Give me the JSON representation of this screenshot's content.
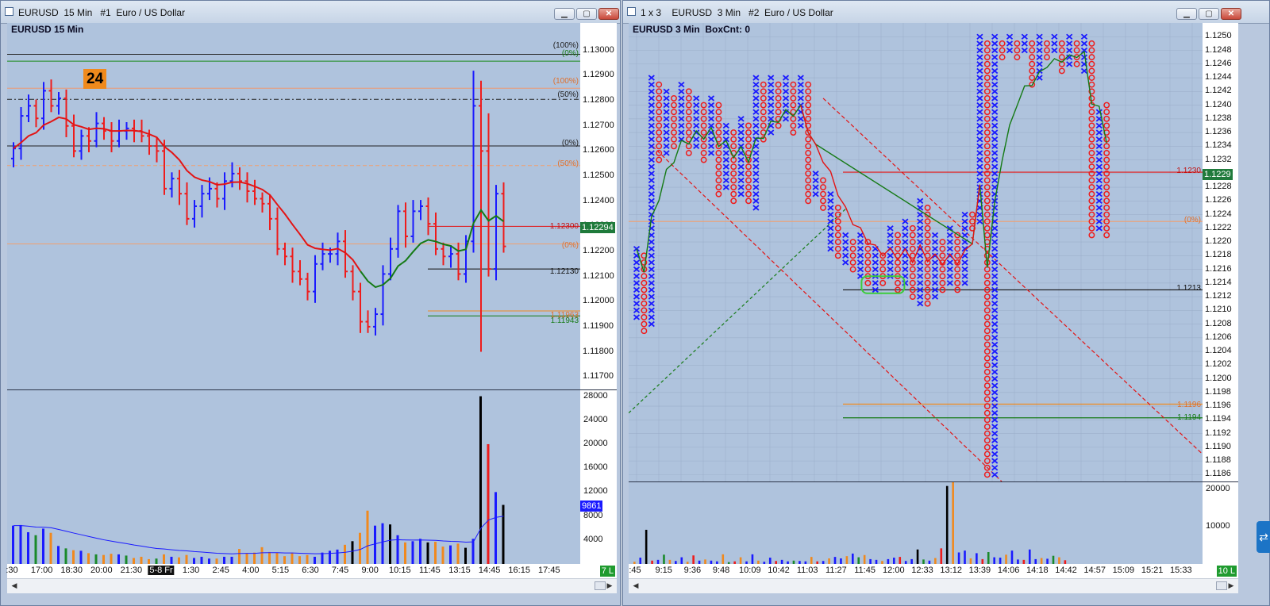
{
  "left_window": {
    "title": "EURUSD  15 Min   #1  Euro / US Dollar",
    "chart_label": "EURUSD 15 Min",
    "badge": "24",
    "price_tags": {
      "current": "1.12294",
      "level_red": "1.12300",
      "level_black": "1.12130",
      "level_orange": "1.11963",
      "level_green": "1.11943"
    },
    "volume_tag": "9861",
    "corner_tag": "7 L",
    "date_marker": "5-8 Fr",
    "fib_labels": [
      "(100%)",
      "(0%)",
      "(100%)",
      "(50%)",
      "(0%)",
      "(50%)",
      "(0%)"
    ]
  },
  "right_window": {
    "title": "1 x 3    EURUSD  3 Min   #2  Euro / US Dollar",
    "chart_label": "EURUSD 3 Min  BoxCnt: 0",
    "price_tags": {
      "current": "1.1229",
      "level_red": "1.1230",
      "level_black": "1.1213",
      "level_orange": "1.1196",
      "level_green": "1.1194",
      "fib_zero": "(0%)"
    },
    "corner_tag": "10 L"
  },
  "colors": {
    "up": "#1a1aff",
    "down": "#ee1c1c",
    "ma_red": "#e31414",
    "ma_green": "#157a15",
    "orange": "#f0891e",
    "bg": "#afc3dd"
  },
  "chart_data": [
    {
      "type": "ohlc",
      "title": "EURUSD 15 Min",
      "ylim": [
        1.1165,
        1.1311
      ],
      "yticks": [
        "1.13000",
        "1.12900",
        "1.12800",
        "1.12700",
        "1.12600",
        "1.12500",
        "1.12400",
        "1.12300",
        "1.12200",
        "1.12100",
        "1.12000",
        "1.11900",
        "1.11800",
        "1.11700"
      ],
      "x_ticks": [
        ":30",
        "17:00",
        "18:30",
        "20:00",
        "21:30",
        "5-8 Fr",
        "1:30",
        "2:45",
        "4:00",
        "5:15",
        "6:30",
        "7:45",
        "9:00",
        "10:15",
        "11:45",
        "13:15",
        "14:45",
        "16:15",
        "17:45"
      ],
      "close": [
        1.1261,
        1.1274,
        1.1278,
        1.1273,
        1.1284,
        1.1278,
        1.1281,
        1.127,
        1.126,
        1.1266,
        1.1264,
        1.1271,
        1.1268,
        1.1264,
        1.1268,
        1.1269,
        1.1268,
        1.1266,
        1.1262,
        1.126,
        1.1245,
        1.1249,
        1.1243,
        1.1233,
        1.1238,
        1.1243,
        1.1245,
        1.1241,
        1.1248,
        1.1251,
        1.1248,
        1.1244,
        1.1241,
        1.1239,
        1.1233,
        1.1221,
        1.1218,
        1.1212,
        1.1209,
        1.1204,
        1.1215,
        1.1219,
        1.1219,
        1.1224,
        1.1212,
        1.1204,
        1.1192,
        1.119,
        1.1195,
        1.1211,
        1.1221,
        1.1236,
        1.1226,
        1.1236,
        1.1238,
        1.1231,
        1.1221,
        1.1218,
        1.1219,
        1.1211,
        1.1224,
        1.1278,
        1.126,
        1.1213,
        1.1243,
        1.1222
      ],
      "volume_ylim": [
        0,
        29000
      ],
      "volume_yticks": [
        "28000",
        "24000",
        "20000",
        "16000",
        "12000",
        "8000",
        "4000"
      ],
      "volume": [
        6400,
        6500,
        5300,
        4800,
        5900,
        5200,
        3000,
        2600,
        2300,
        2200,
        1800,
        1600,
        1500,
        1700,
        1600,
        1400,
        1000,
        1200,
        800,
        900,
        1600,
        1200,
        1100,
        1500,
        1000,
        1200,
        900,
        900,
        1200,
        1200,
        2500,
        1800,
        1900,
        2800,
        2000,
        1900,
        1300,
        1900,
        1300,
        1500,
        1200,
        1900,
        2200,
        2400,
        3200,
        3800,
        5200,
        8900,
        6400,
        6800,
        6600,
        4800,
        3600,
        3800,
        4200,
        3600,
        3700,
        2900,
        3100,
        3400,
        2700,
        4200,
        28000,
        20000,
        12000,
        9861
      ]
    },
    {
      "type": "point-and-figure",
      "title": "EURUSD 3 Min",
      "ylim": [
        1.1185,
        1.1252
      ],
      "yticks": [
        "1.1250",
        "1.1248",
        "1.1246",
        "1.1244",
        "1.1242",
        "1.1240",
        "1.1238",
        "1.1236",
        "1.1234",
        "1.1232",
        "1.1230",
        "1.1228",
        "1.1226",
        "1.1224",
        "1.1222",
        "1.1220",
        "1.1218",
        "1.1216",
        "1.1214",
        "1.1212",
        "1.1210",
        "1.1208",
        "1.1206",
        "1.1204",
        "1.1202",
        "1.1200",
        "1.1198",
        "1.1196",
        "1.1194",
        "1.1192",
        "1.1190",
        "1.1188",
        "1.1186"
      ],
      "x_ticks": [
        ":45",
        "9:15",
        "9:36",
        "9:48",
        "10:09",
        "10:42",
        "11:03",
        "11:27",
        "11:45",
        "12:00",
        "12:33",
        "13:12",
        "13:39",
        "14:06",
        "14:18",
        "14:42",
        "14:57",
        "15:09",
        "15:21",
        "15:33"
      ],
      "columns": [
        {
          "t": "X",
          "low": 1.1209,
          "high": 1.1219
        },
        {
          "t": "O",
          "low": 1.1207,
          "high": 1.1218
        },
        {
          "t": "X",
          "low": 1.1208,
          "high": 1.1244
        },
        {
          "t": "O",
          "low": 1.1232,
          "high": 1.1243
        },
        {
          "t": "X",
          "low": 1.1233,
          "high": 1.1242
        },
        {
          "t": "O",
          "low": 1.1234,
          "high": 1.1241
        },
        {
          "t": "X",
          "low": 1.1235,
          "high": 1.1243
        },
        {
          "t": "O",
          "low": 1.1233,
          "high": 1.1242
        },
        {
          "t": "X",
          "low": 1.1234,
          "high": 1.1241
        },
        {
          "t": "O",
          "low": 1.1232,
          "high": 1.124
        },
        {
          "t": "X",
          "low": 1.1233,
          "high": 1.1241
        },
        {
          "t": "O",
          "low": 1.1227,
          "high": 1.124
        },
        {
          "t": "X",
          "low": 1.1228,
          "high": 1.1237
        },
        {
          "t": "O",
          "low": 1.1226,
          "high": 1.1236
        },
        {
          "t": "X",
          "low": 1.1227,
          "high": 1.1238
        },
        {
          "t": "O",
          "low": 1.1226,
          "high": 1.1237
        },
        {
          "t": "X",
          "low": 1.1225,
          "high": 1.1244
        },
        {
          "t": "O",
          "low": 1.1235,
          "high": 1.1243
        },
        {
          "t": "X",
          "low": 1.1236,
          "high": 1.1244
        },
        {
          "t": "O",
          "low": 1.1237,
          "high": 1.1243
        },
        {
          "t": "X",
          "low": 1.1238,
          "high": 1.1244
        },
        {
          "t": "O",
          "low": 1.1236,
          "high": 1.1243
        },
        {
          "t": "X",
          "low": 1.1237,
          "high": 1.1244
        },
        {
          "t": "O",
          "low": 1.1226,
          "high": 1.1243
        },
        {
          "t": "X",
          "low": 1.1227,
          "high": 1.123
        },
        {
          "t": "O",
          "low": 1.1225,
          "high": 1.1229
        },
        {
          "t": "X",
          "low": 1.1219,
          "high": 1.1227
        },
        {
          "t": "O",
          "low": 1.1218,
          "high": 1.1225
        },
        {
          "t": "X",
          "low": 1.1217,
          "high": 1.1221
        },
        {
          "t": "O",
          "low": 1.1216,
          "high": 1.122
        },
        {
          "t": "X",
          "low": 1.1215,
          "high": 1.1221
        },
        {
          "t": "O",
          "low": 1.1214,
          "high": 1.122
        },
        {
          "t": "X",
          "low": 1.1213,
          "high": 1.1219
        },
        {
          "t": "O",
          "low": 1.1214,
          "high": 1.1218
        },
        {
          "t": "X",
          "low": 1.1215,
          "high": 1.1222
        },
        {
          "t": "O",
          "low": 1.1213,
          "high": 1.1221
        },
        {
          "t": "X",
          "low": 1.1214,
          "high": 1.1223
        },
        {
          "t": "O",
          "low": 1.1212,
          "high": 1.1222
        },
        {
          "t": "X",
          "low": 1.1211,
          "high": 1.1226
        },
        {
          "t": "O",
          "low": 1.1211,
          "high": 1.1225
        },
        {
          "t": "X",
          "low": 1.1212,
          "high": 1.1221
        },
        {
          "t": "O",
          "low": 1.1213,
          "high": 1.122
        },
        {
          "t": "X",
          "low": 1.1214,
          "high": 1.1222
        },
        {
          "t": "O",
          "low": 1.1213,
          "high": 1.1221
        },
        {
          "t": "X",
          "low": 1.1214,
          "high": 1.1224
        },
        {
          "t": "O",
          "low": 1.1222,
          "high": 1.1224
        },
        {
          "t": "X",
          "low": 1.1223,
          "high": 1.125
        },
        {
          "t": "O",
          "low": 1.1186,
          "high": 1.1249
        },
        {
          "t": "X",
          "low": 1.1186,
          "high": 1.125
        },
        {
          "t": "O",
          "low": 1.1247,
          "high": 1.1249
        },
        {
          "t": "X",
          "low": 1.1248,
          "high": 1.125
        },
        {
          "t": "O",
          "low": 1.1247,
          "high": 1.1249
        },
        {
          "t": "X",
          "low": 1.1248,
          "high": 1.125
        },
        {
          "t": "O",
          "low": 1.1243,
          "high": 1.1249
        },
        {
          "t": "X",
          "low": 1.1244,
          "high": 1.125
        },
        {
          "t": "O",
          "low": 1.1247,
          "high": 1.1249
        },
        {
          "t": "X",
          "low": 1.1248,
          "high": 1.125
        },
        {
          "t": "O",
          "low": 1.1245,
          "high": 1.1249
        },
        {
          "t": "X",
          "low": 1.1246,
          "high": 1.125
        },
        {
          "t": "O",
          "low": 1.1246,
          "high": 1.1249
        },
        {
          "t": "X",
          "low": 1.1245,
          "high": 1.125
        },
        {
          "t": "O",
          "low": 1.1221,
          "high": 1.1249
        },
        {
          "t": "X",
          "low": 1.1222,
          "high": 1.1239
        },
        {
          "t": "O",
          "low": 1.1221,
          "high": 1.124
        }
      ],
      "volume_ylim": [
        0,
        22000
      ],
      "volume_yticks": [
        "20000",
        "10000"
      ],
      "volume": [
        600,
        1700,
        9200,
        900,
        1100,
        2500,
        1100,
        800,
        1800,
        600,
        2300,
        900,
        1200,
        900,
        700,
        2600,
        500,
        700,
        1800,
        700,
        2600,
        900,
        600,
        1700,
        800,
        1100,
        700,
        900,
        800,
        700,
        1900,
        700,
        800,
        1500,
        1900,
        1500,
        2100,
        2800,
        1800,
        2400,
        1300,
        1100,
        800,
        1300,
        1700,
        1900,
        800,
        1300,
        3900,
        1200,
        900,
        1600,
        4200,
        21000,
        22000,
        3100,
        3600,
        1500,
        2900,
        1300,
        3200,
        1800,
        1700,
        2500,
        3600,
        1200,
        1100,
        3900,
        1300,
        1600,
        1400,
        2200,
        1800,
        1000
      ]
    }
  ]
}
